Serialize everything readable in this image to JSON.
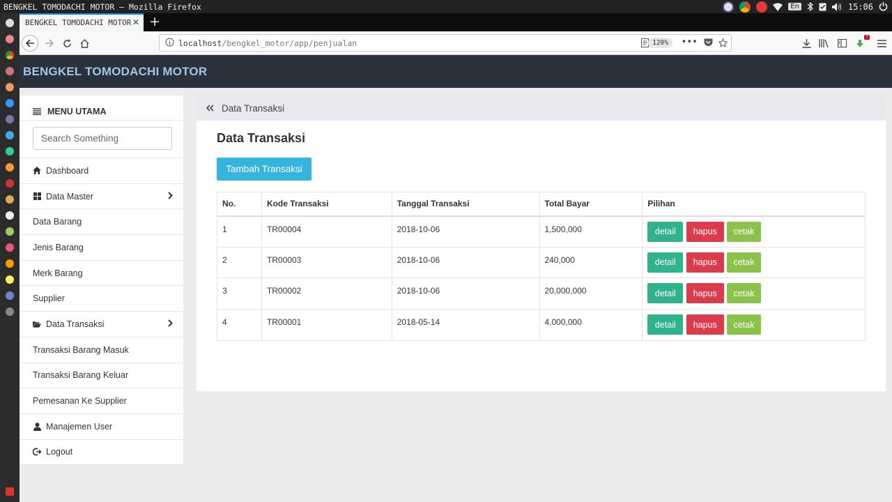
{
  "os": {
    "window_title": "BENGKEL TOMODACHI MOTOR – Mozilla Firefox",
    "lang": "En",
    "clock": "15:06"
  },
  "browser": {
    "tab_title": "BENGKEL TOMODACHI MOTOR",
    "url_host": "localhost",
    "url_path": "/bengkel_motor/app/penjualan",
    "zoom": "120%",
    "notification_count": "7"
  },
  "app": {
    "title": "BENGKEL TOMODACHI MOTOR"
  },
  "sidebar": {
    "heading": "MENU UTAMA",
    "search_placeholder": "Search Something",
    "items": [
      {
        "label": "Dashboard",
        "icon": "home-icon"
      },
      {
        "label": "Data Master",
        "icon": "grid-icon"
      },
      {
        "label": "Data Barang"
      },
      {
        "label": "Jenis Barang"
      },
      {
        "label": "Merk Barang"
      },
      {
        "label": "Supplier"
      },
      {
        "label": "Data Transaksi",
        "icon": "folder-open-icon"
      },
      {
        "label": "Transaksi Barang Masuk"
      },
      {
        "label": "Transaksi Barang Keluar"
      },
      {
        "label": "Pemesanan Ke Supplier"
      },
      {
        "label": "Manajemen User",
        "icon": "user-icon"
      },
      {
        "label": "Logout",
        "icon": "logout-icon"
      }
    ]
  },
  "main": {
    "breadcrumb": "Data Transaksi",
    "title": "Data Transaksi",
    "add_button": "Tambah Transaksi",
    "table": {
      "headers": [
        "No.",
        "Kode Transaksi",
        "Tanggal Transaksi",
        "Total Bayar",
        "Pilihan"
      ],
      "rows": [
        {
          "no": "1",
          "kode": "TR00004",
          "tanggal": "2018-10-06",
          "total": "1,500,000"
        },
        {
          "no": "2",
          "kode": "TR00003",
          "tanggal": "2018-10-06",
          "total": "240,000"
        },
        {
          "no": "3",
          "kode": "TR00002",
          "tanggal": "2018-10-06",
          "total": "20,000,000"
        },
        {
          "no": "4",
          "kode": "TR00001",
          "tanggal": "2018-05-14",
          "total": "4,000,000"
        }
      ],
      "actions": {
        "detail": "detail",
        "hapus": "hapus",
        "cetak": "cetak"
      }
    }
  },
  "colors": {
    "header_bg": "#2b313b",
    "brand_text": "#a2c6e6",
    "primary_button": "#35b5dd",
    "detail_button": "#2fb38d",
    "hapus_button": "#dc3b4a",
    "cetak_button": "#8bc34a"
  }
}
